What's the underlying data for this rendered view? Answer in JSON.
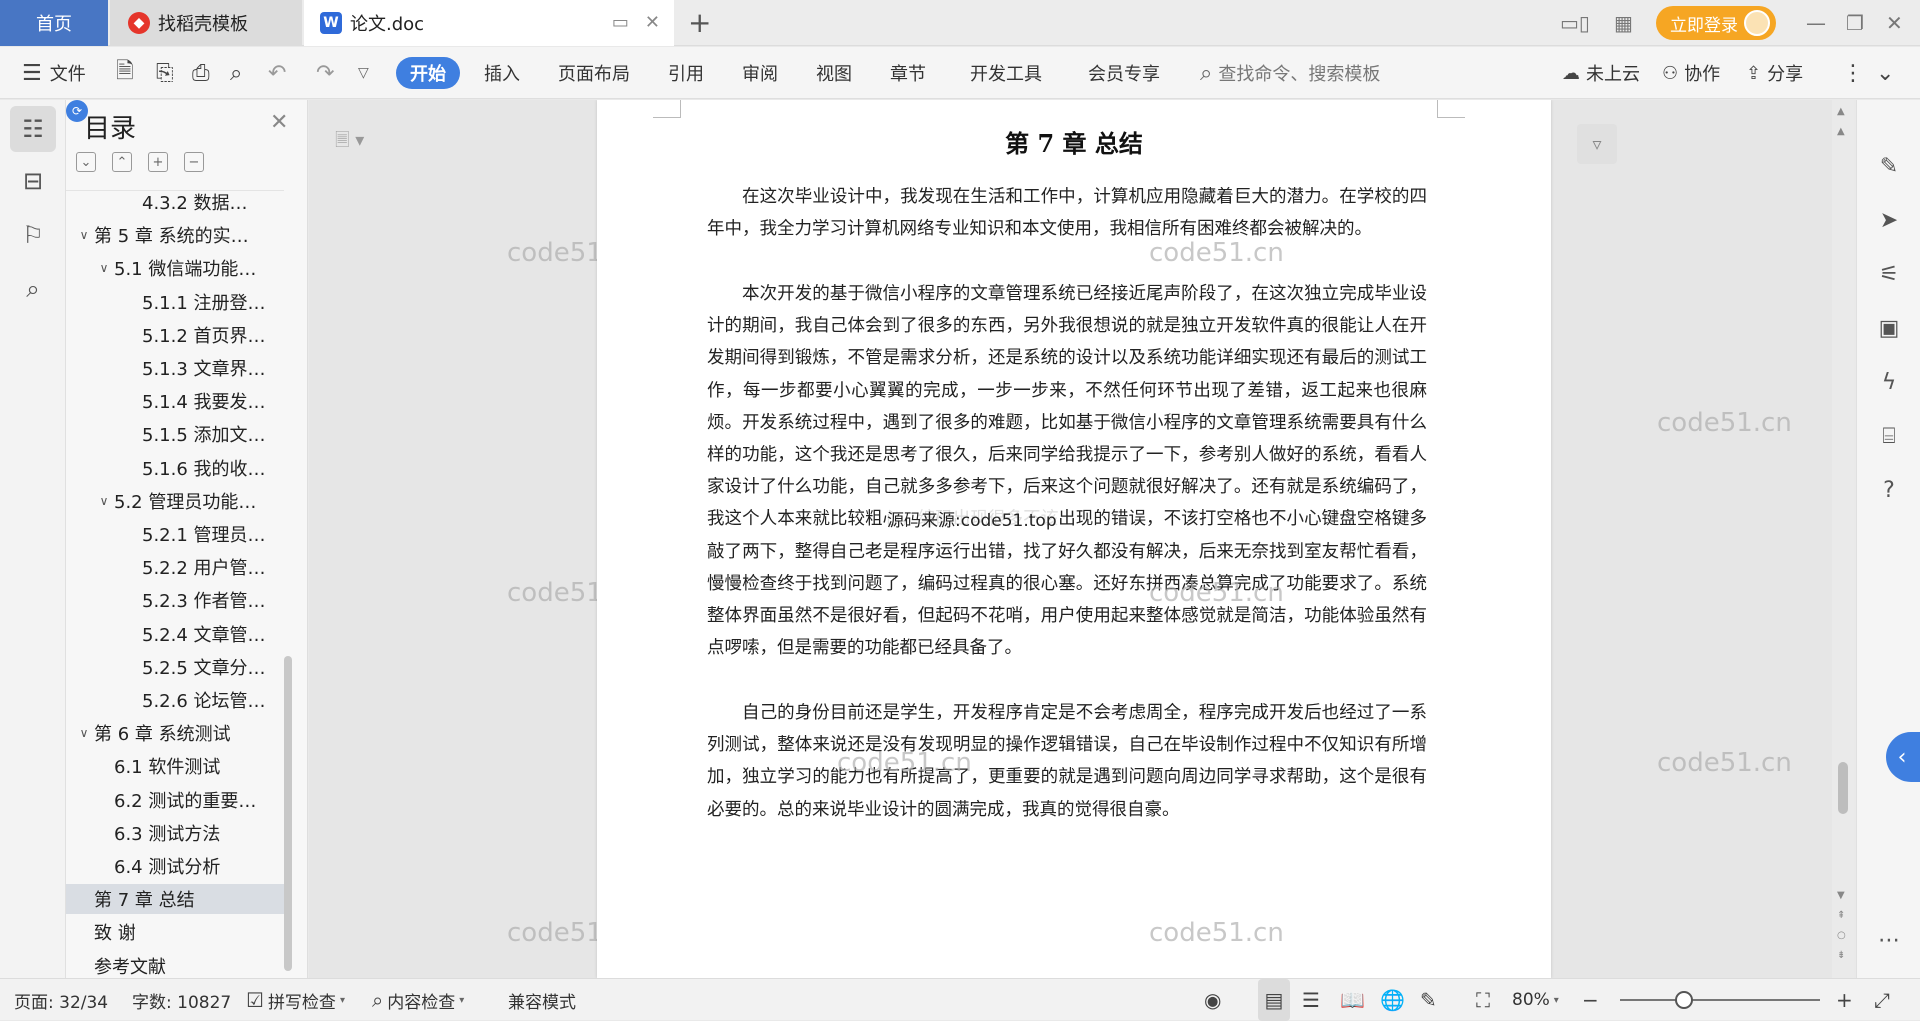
{
  "tabs": {
    "home": "首页",
    "template": "找稻壳模板",
    "doc": "论文.doc",
    "new_tab": "+"
  },
  "window": {
    "login": "立即登录",
    "min": "—",
    "restore": "❐",
    "close": "✕"
  },
  "ribbon": {
    "file": "文件",
    "tabs": [
      "开始",
      "插入",
      "页面布局",
      "引用",
      "审阅",
      "视图",
      "章节",
      "开发工具",
      "会员专享"
    ],
    "search_placeholder": "查找命令、搜索模板",
    "cloud": "未上云",
    "collab": "协作",
    "share": "分享"
  },
  "toc": {
    "title": "目录",
    "items": [
      {
        "label": "4.3.2 数据…",
        "level": 3,
        "arrow": ""
      },
      {
        "label": "第 5 章 系统的实…",
        "level": 1,
        "arrow": "∨"
      },
      {
        "label": "5.1 微信端功能…",
        "level": 2,
        "arrow": "∨"
      },
      {
        "label": "5.1.1 注册登…",
        "level": 3,
        "arrow": ""
      },
      {
        "label": "5.1.2 首页界…",
        "level": 3,
        "arrow": ""
      },
      {
        "label": "5.1.3 文章界…",
        "level": 3,
        "arrow": ""
      },
      {
        "label": "5.1.4 我要发…",
        "level": 3,
        "arrow": ""
      },
      {
        "label": "5.1.5 添加文…",
        "level": 3,
        "arrow": ""
      },
      {
        "label": "5.1.6 我的收…",
        "level": 3,
        "arrow": ""
      },
      {
        "label": "5.2 管理员功能…",
        "level": 2,
        "arrow": "∨"
      },
      {
        "label": "5.2.1 管理员…",
        "level": 3,
        "arrow": ""
      },
      {
        "label": "5.2.2 用户管…",
        "level": 3,
        "arrow": ""
      },
      {
        "label": "5.2.3 作者管…",
        "level": 3,
        "arrow": ""
      },
      {
        "label": "5.2.4 文章管…",
        "level": 3,
        "arrow": ""
      },
      {
        "label": "5.2.5 文章分…",
        "level": 3,
        "arrow": ""
      },
      {
        "label": "5.2.6 论坛管…",
        "level": 3,
        "arrow": ""
      },
      {
        "label": "第 6 章 系统测试",
        "level": 1,
        "arrow": "∨"
      },
      {
        "label": "6.1 软件测试",
        "level": 2,
        "arrow": ""
      },
      {
        "label": "6.2 测试的重要…",
        "level": 2,
        "arrow": ""
      },
      {
        "label": "6.3 测试方法",
        "level": 2,
        "arrow": ""
      },
      {
        "label": "6.4 测试分析",
        "level": 2,
        "arrow": ""
      },
      {
        "label": "第 7 章 总结",
        "level": 1,
        "arrow": "",
        "selected": true
      },
      {
        "label": "致 谢",
        "level": 1,
        "arrow": ""
      },
      {
        "label": "参考文献",
        "level": 1,
        "arrow": ""
      }
    ]
  },
  "document": {
    "title": "第 7 章 总结",
    "paragraphs": [
      "在这次毕业设计中，我发现在生活和工作中，计算机应用隐藏着巨大的潜力。在学校的四年中，我全力学习计算机网络专业知识和本文使用，我相信所有困难终都会被解决的。",
      "本次开发的基于微信小程序的文章管理系统已经接近尾声阶段了，在这次独立完成毕业设计的期间，我自己体会到了很多的东西，另外我很想说的就是独立开发软件真的很能让人在开发期间得到锻炼，不管是需求分析，还是系统的设计以及系统功能详细实现还有最后的测试工作，每一步都要小心翼翼的完成，一步一步来，不然任何环节出现了差错，返工起来也很麻烦。开发系统过程中，遇到了很多的难题，比如基于微信小程序的文章管理系统需要具有什么样的功能，这个我还是思考了很久，后来同学给我提示了一下，参考别人做好的系统，看看人家设计了什么功能，自己就多多参考下，后来这个问题就很好解决了。还有就是系统编码了，我这个人本来就比较粗心，编码出现很多不该出现的错误，不该打空格也不小心键盘空格键多敲了两下，整得自己老是程序运行出错，找了好久都没有解决，后来无奈找到室友帮忙看看，慢慢检查终于找到问题了，编码过程真的很心塞。还好东拼西凑总算完成了功能要求了。系统整体界面虽然不是很好看，但起码不花哨，用户使用起来整体感觉就是简洁，功能体验虽然有点啰嗦，但是需要的功能都已经具备了。",
      "自己的身份目前还是学生，开发程序肯定是不会考虑周全，程序完成开发后也经过了一系列测试，整体来说还是没有发现明显的操作逻辑错误，自己在毕设制作过程中不仅知识有所增加，独立学习的能力也有所提高了，更重要的就是遇到问题向周边同学寻求帮助，这个是很有必要的。总的来说毕业设计的圆满完成，我真的觉得很自豪。"
    ],
    "overlay_text": "源码来源:code51.top",
    "watermark": "code51.cn"
  },
  "status": {
    "page": "页面: 32/34",
    "words": "字数: 10827",
    "spell": "拼写检查",
    "content_check": "内容检查",
    "compat": "兼容模式",
    "zoom": "80%",
    "zoom_level": 0.32
  }
}
